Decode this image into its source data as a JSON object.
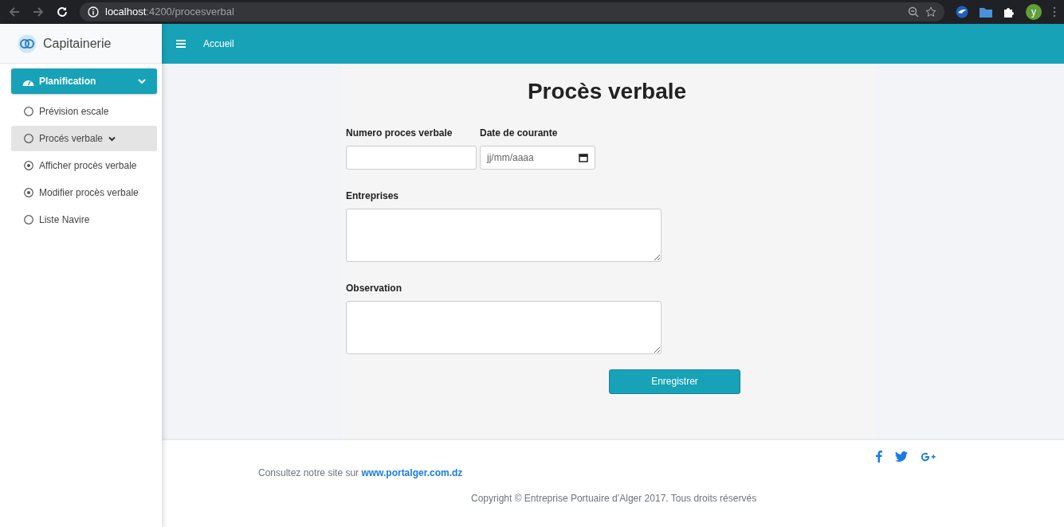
{
  "browser": {
    "url_host": "localhost",
    "url_path": ":4200/procesverbal",
    "avatar": "y"
  },
  "sidebar": {
    "brand": "Capitainerie",
    "group": {
      "label": "Planification",
      "expanded": true
    },
    "items": [
      {
        "label": "Prévision escale",
        "selected": false
      },
      {
        "label": "Procés verbale",
        "selected": true,
        "expanded": true,
        "children": [
          {
            "label": "Afficher procès verbale"
          },
          {
            "label": "Modifier procès verbale"
          }
        ]
      },
      {
        "label": "Liste Navire",
        "selected": false
      }
    ]
  },
  "topbar": {
    "link": "Accueil"
  },
  "form": {
    "title": "Procès verbale",
    "fields": [
      {
        "kind": "text",
        "label": "Numero proces verbale"
      },
      {
        "kind": "date",
        "label": "Date de courante",
        "placeholder": "jj/mm/aaaa"
      },
      {
        "kind": "textarea",
        "label": "Entreprises"
      },
      {
        "kind": "textarea",
        "label": "Observation"
      }
    ],
    "submit": "Enregistrer"
  },
  "footer": {
    "text": "Consultez notre site sur",
    "link": "www.portalger.com.dz",
    "copyright": "Copyright © Entreprise Portuaire d’Alger 2017. Tous droits réservés"
  }
}
